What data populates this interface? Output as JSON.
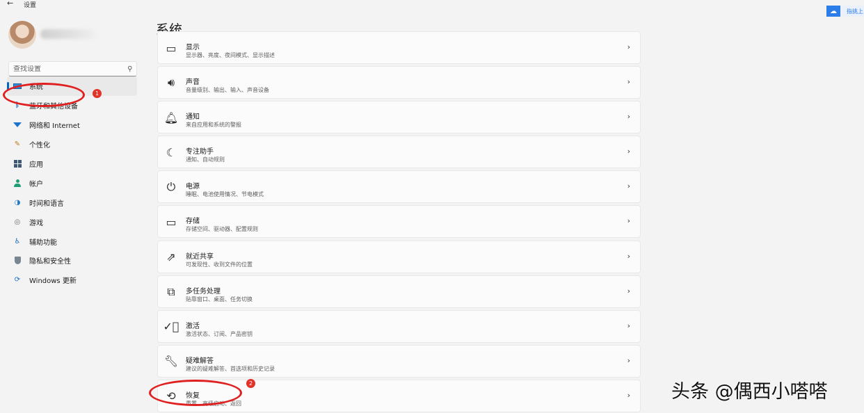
{
  "window": {
    "back_glyph": "←",
    "title": "设置"
  },
  "capture_widget": {
    "label": "指挑上"
  },
  "sidebar": {
    "search": {
      "placeholder": "查找设置"
    },
    "items": [
      {
        "label": "系统",
        "icon": "monitor-icon",
        "active": true
      },
      {
        "label": "蓝牙和其他设备",
        "icon": "bluetooth-icon"
      },
      {
        "label": "网络和 Internet",
        "icon": "wifi-icon"
      },
      {
        "label": "个性化",
        "icon": "brush-icon"
      },
      {
        "label": "应用",
        "icon": "apps-icon"
      },
      {
        "label": "帐户",
        "icon": "account-icon"
      },
      {
        "label": "时间和语言",
        "icon": "clock-globe-icon"
      },
      {
        "label": "游戏",
        "icon": "gamepad-icon"
      },
      {
        "label": "辅助功能",
        "icon": "accessibility-icon"
      },
      {
        "label": "隐私和安全性",
        "icon": "shield-icon"
      },
      {
        "label": "Windows 更新",
        "icon": "update-icon"
      }
    ]
  },
  "main": {
    "title": "系统",
    "settings": [
      {
        "title": "显示",
        "desc": "显示器、亮度、夜间模式、显示描述",
        "icon": "display-icon"
      },
      {
        "title": "声音",
        "desc": "音量级别、输出、输入、声音设备",
        "icon": "speaker-icon"
      },
      {
        "title": "通知",
        "desc": "来自应用和系统的警报",
        "icon": "bell-icon"
      },
      {
        "title": "专注助手",
        "desc": "通知、自动规则",
        "icon": "moon-icon"
      },
      {
        "title": "电源",
        "desc": "睡眠、电池使用情况、节电模式",
        "icon": "power-icon"
      },
      {
        "title": "存储",
        "desc": "存储空间、驱动器、配置规则",
        "icon": "storage-icon"
      },
      {
        "title": "就近共享",
        "desc": "可发现性、收到文件的位置",
        "icon": "share-icon"
      },
      {
        "title": "多任务处理",
        "desc": "贴靠窗口、桌面、任务切换",
        "icon": "multitask-icon"
      },
      {
        "title": "激活",
        "desc": "激活状态、订阅、产品密钥",
        "icon": "activation-icon"
      },
      {
        "title": "疑难解答",
        "desc": "建议的疑难解答、首选项和历史记录",
        "icon": "wrench-icon"
      },
      {
        "title": "恢复",
        "desc": "重置、高级启动、返回",
        "icon": "recovery-icon"
      }
    ]
  },
  "annotations": {
    "badge_1": "1",
    "badge_2": "2",
    "color": "#e02020"
  },
  "watermark": "头条 @偶西小嗒嗒",
  "colors": {
    "accent": "#0067c0",
    "background": "#f3f3f3",
    "card": "#fbfbfb"
  }
}
